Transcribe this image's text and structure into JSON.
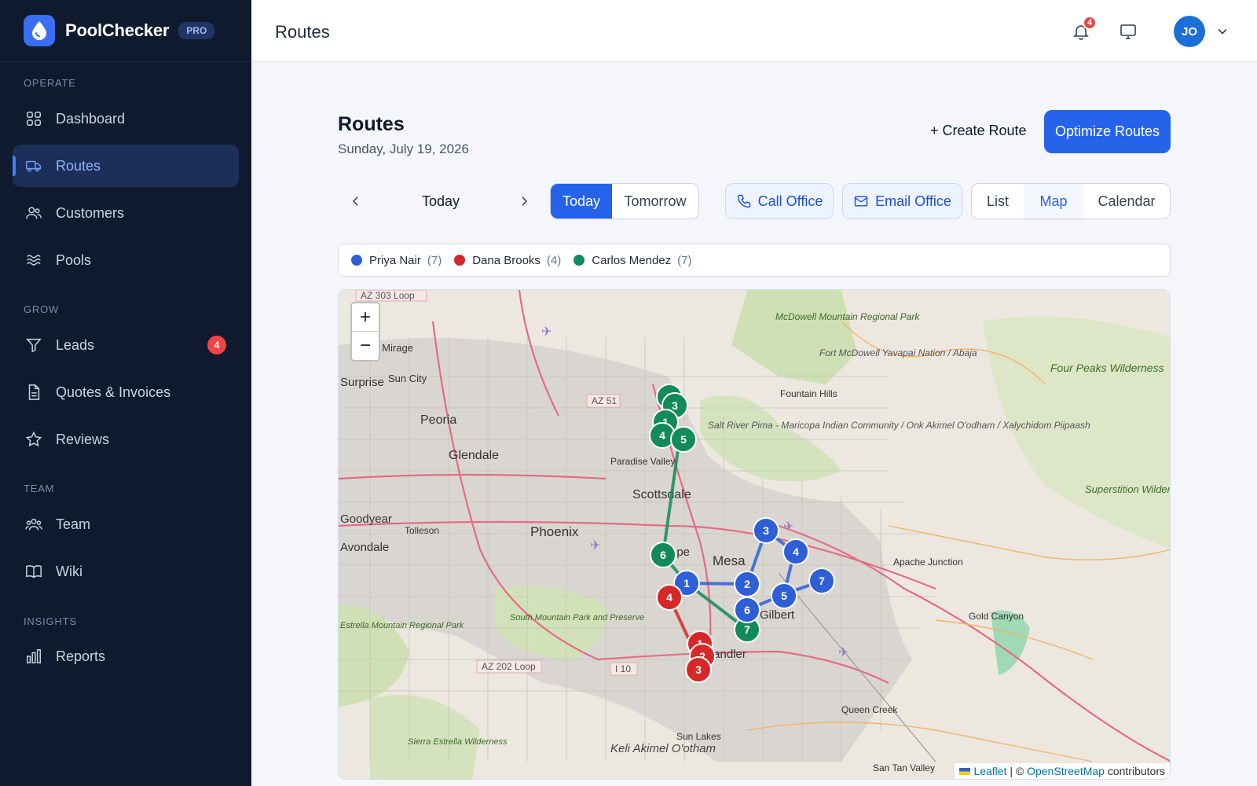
{
  "brand": {
    "name": "PoolChecker",
    "badge": "PRO"
  },
  "sidebar": {
    "sections": [
      {
        "label": "OPERATE"
      },
      {
        "label": "GROW"
      },
      {
        "label": "TEAM"
      },
      {
        "label": "INSIGHTS"
      }
    ],
    "items": [
      {
        "label": "Dashboard",
        "icon": "grid-icon"
      },
      {
        "label": "Routes",
        "icon": "truck-icon",
        "active": true
      },
      {
        "label": "Customers",
        "icon": "users-icon"
      },
      {
        "label": "Pools",
        "icon": "waves-icon"
      },
      {
        "label": "Leads",
        "icon": "funnel-icon",
        "badge": "4"
      },
      {
        "label": "Quotes & Invoices",
        "icon": "document-icon"
      },
      {
        "label": "Reviews",
        "icon": "star-icon"
      },
      {
        "label": "Team",
        "icon": "team-icon"
      },
      {
        "label": "Wiki",
        "icon": "book-icon"
      },
      {
        "label": "Reports",
        "icon": "bar-chart-icon"
      }
    ]
  },
  "topbar": {
    "title": "Routes",
    "notifications": "4",
    "avatar": "JO"
  },
  "main": {
    "title": "Routes",
    "date": "Sunday, July 19, 2026",
    "create_route": "+ Create Route",
    "optimize": "Optimize Routes",
    "current_day": "Today",
    "day_toggle": [
      "Today",
      "Tomorrow"
    ],
    "call_office": "Call Office",
    "email_office": "Email Office",
    "views": [
      "List",
      "Map",
      "Calendar"
    ],
    "selected_view": "Map"
  },
  "legend": [
    {
      "name": "Priya Nair",
      "count": "(7)",
      "color": "#2f5fd6"
    },
    {
      "name": "Dana Brooks",
      "count": "(4)",
      "color": "#d62828"
    },
    {
      "name": "Carlos Mendez",
      "count": "(7)",
      "color": "#138a5a"
    }
  ],
  "map": {
    "zoom_in": "+",
    "zoom_out": "−",
    "attribution_leaflet": "Leaflet",
    "attribution_sep": " | © ",
    "attribution_osm": "OpenStreetMap",
    "attribution_tail": " contributors",
    "place_labels": [
      "AZ 303 Loop",
      "Sun City",
      "Peoria",
      "Glendale",
      "AZ 51",
      "Paradise Valley",
      "Scottsdale",
      "Phoenix",
      "Tolleson",
      "Tempe",
      "Mesa",
      "Gilbert",
      "Chandler",
      "McDowell Mountain Regional Park",
      "Fort McDowell Yavapai Nation / Abaja",
      "Fountain Hills",
      "Salt River Pima - Maricopa Indian Community / Onk Akimel O'odham / Xalychidom Piipaash",
      "Four Peaks Wilderness",
      "Superstition Wilderness",
      "Apache Junction",
      "Gold Canyon",
      "South Mountain Park and Preserve",
      "AZ 202 Loop",
      "I 10",
      "Estrella Mountain Regional Park",
      "Sierra Estrella Wilderness",
      "Keli Akimel O'otham",
      "Sun Lakes",
      "Queen Creek",
      "San Tan Valley",
      "Avondale",
      "Goodyear",
      "Surprise",
      "El Mirage"
    ],
    "stops": {
      "priya": [
        "1",
        "2",
        "3",
        "4",
        "5",
        "6",
        "7"
      ],
      "dana": [
        "1",
        "2",
        "3",
        "4"
      ],
      "carlos": [
        "1",
        "2",
        "3",
        "4",
        "5",
        "6",
        "7"
      ]
    }
  }
}
